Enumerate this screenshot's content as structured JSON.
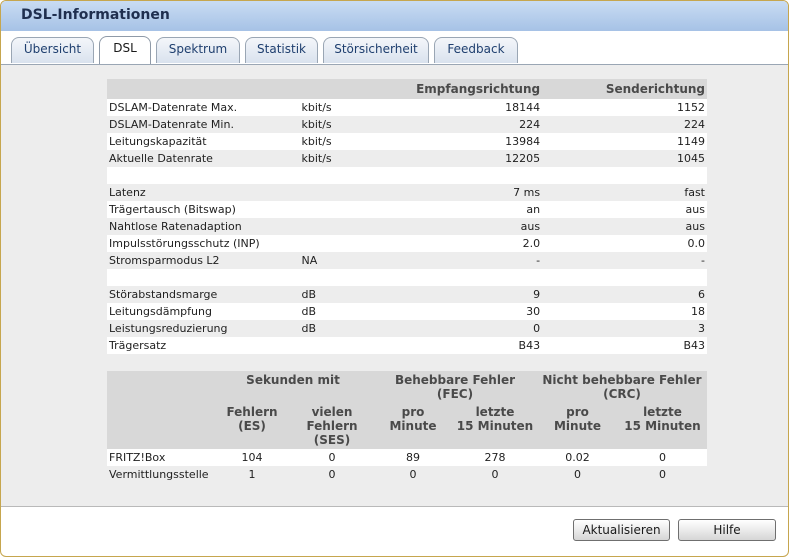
{
  "window": {
    "title": "DSL-Informationen"
  },
  "tabs": [
    {
      "label": "Übersicht"
    },
    {
      "label": "DSL"
    },
    {
      "label": "Spektrum"
    },
    {
      "label": "Statistik"
    },
    {
      "label": "Störsicherheit"
    },
    {
      "label": "Feedback"
    }
  ],
  "active_tab": "DSL",
  "info_table": {
    "headers": {
      "col_empfang": "Empfangsrichtung",
      "col_sende": "Senderichtung"
    },
    "rows": [
      {
        "label": "DSLAM-Datenrate Max.",
        "unit": "kbit/s",
        "empfang": "18144",
        "sende": "1152"
      },
      {
        "label": "DSLAM-Datenrate Min.",
        "unit": "kbit/s",
        "empfang": "224",
        "sende": "224"
      },
      {
        "label": "Leitungskapazität",
        "unit": "kbit/s",
        "empfang": "13984",
        "sende": "1149"
      },
      {
        "label": "Aktuelle Datenrate",
        "unit": "kbit/s",
        "empfang": "12205",
        "sende": "1045"
      },
      {
        "label": "",
        "unit": "",
        "empfang": "",
        "sende": ""
      },
      {
        "label": "Latenz",
        "unit": "",
        "empfang": "7 ms",
        "sende": "fast"
      },
      {
        "label": "Trägertausch (Bitswap)",
        "unit": "",
        "empfang": "an",
        "sende": "aus"
      },
      {
        "label": "Nahtlose Ratenadaption",
        "unit": "",
        "empfang": "aus",
        "sende": "aus"
      },
      {
        "label": "Impulsstörungsschutz (INP)",
        "unit": "",
        "empfang": "2.0",
        "sende": "0.0"
      },
      {
        "label": "Stromsparmodus L2",
        "unit": "NA",
        "empfang": "-",
        "sende": "-"
      },
      {
        "label": "",
        "unit": "",
        "empfang": "",
        "sende": ""
      },
      {
        "label": "Störabstandsmarge",
        "unit": "dB",
        "empfang": "9",
        "sende": "6"
      },
      {
        "label": "Leitungsdämpfung",
        "unit": "dB",
        "empfang": "30",
        "sende": "18"
      },
      {
        "label": "Leistungsreduzierung",
        "unit": "dB",
        "empfang": "0",
        "sende": "3"
      },
      {
        "label": "Trägersatz",
        "unit": "",
        "empfang": "B43",
        "sende": "B43"
      }
    ]
  },
  "error_table": {
    "group_headers": {
      "sekunden": "Sekunden mit",
      "fec": "Behebbare Fehler (FEC)",
      "crc": "Nicht behebbare Fehler (CRC)"
    },
    "sub_headers": {
      "es_line1": "Fehlern",
      "es_line2": "(ES)",
      "ses_line1": "vielen",
      "ses_line2": "Fehlern",
      "ses_line3": "(SES)",
      "fec_pro_line1": "pro",
      "fec_pro_line2": "Minute",
      "fec_letzte_line1": "letzte",
      "fec_letzte_line2": "15 Minuten",
      "crc_pro_line1": "pro",
      "crc_pro_line2": "Minute",
      "crc_letzte_line1": "letzte",
      "crc_letzte_line2": "15 Minuten"
    },
    "rows": [
      {
        "label": "FRITZ!Box",
        "es": "104",
        "ses": "0",
        "fec_min": "89",
        "fec_15": "278",
        "crc_min": "0.02",
        "crc_15": "0"
      },
      {
        "label": "Vermittlungsstelle",
        "es": "1",
        "ses": "0",
        "fec_min": "0",
        "fec_15": "0",
        "crc_min": "0",
        "crc_15": "0"
      }
    ]
  },
  "buttons": {
    "refresh": "Aktualisieren",
    "help": "Hilfe"
  }
}
